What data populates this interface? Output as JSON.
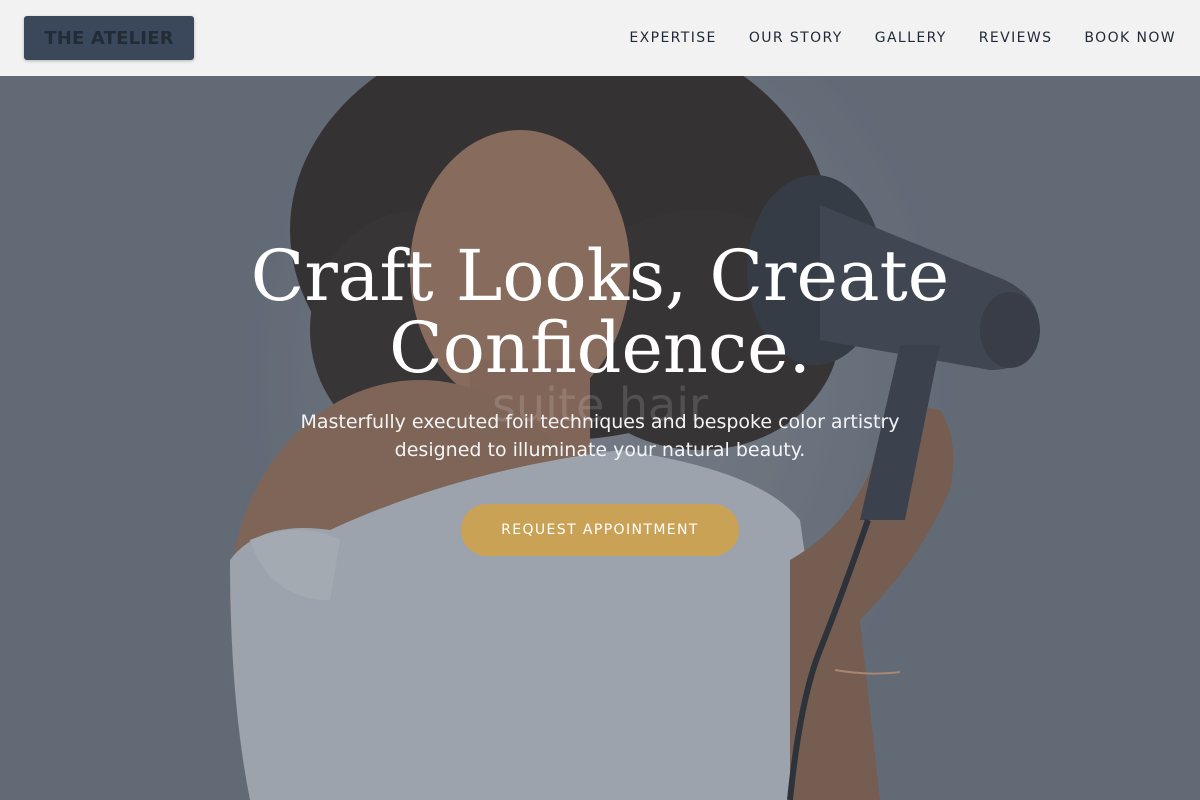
{
  "header": {
    "logo_text": "THE ATELIER",
    "nav": [
      {
        "label": "EXPERTISE"
      },
      {
        "label": "OUR STORY"
      },
      {
        "label": "GALLERY"
      },
      {
        "label": "REVIEWS"
      },
      {
        "label": "BOOK NOW"
      }
    ]
  },
  "hero": {
    "title": "Craft Looks, Create Confidence.",
    "subtitle": "Masterfully executed foil techniques and bespoke color artistry designed to illuminate your natural beauty.",
    "cta_label": "REQUEST APPOINTMENT",
    "watermark_text": "suite hair"
  },
  "colors": {
    "header_bg": "#f2f2f2",
    "logo_bg": "#3b475a",
    "cta_bg": "#c9a255",
    "hero_overlay": "#6b7280"
  }
}
